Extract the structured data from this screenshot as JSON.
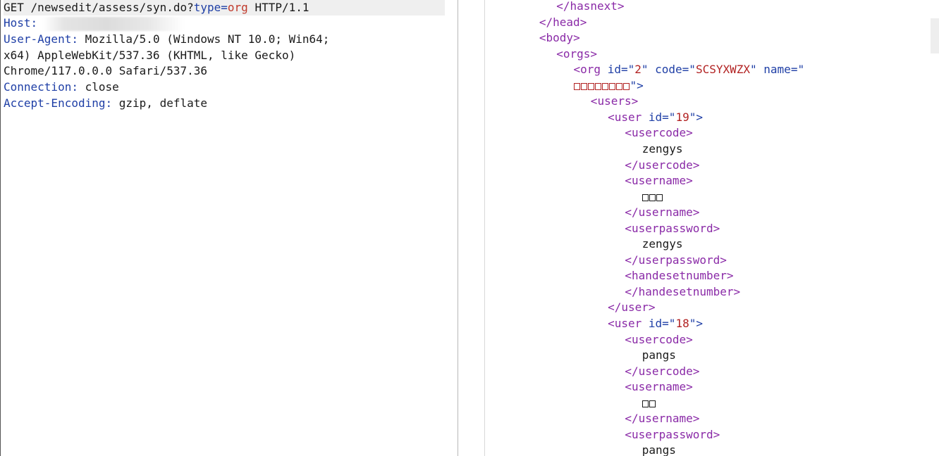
{
  "request": {
    "method": "GET",
    "path": "/newsedit/assess/syn.do?",
    "param_name": "type",
    "param_eq": "=",
    "param_value": "org",
    "protocol": "HTTP/1.1",
    "headers": [
      {
        "name": "Host:",
        "value": ""
      },
      {
        "name": "User-Agent:",
        "value": "Mozilla/5.0 (Windows NT 10.0; Win64;"
      },
      {
        "name": "",
        "value": "x64) AppleWebKit/537.36 (KHTML, like Gecko)"
      },
      {
        "name": "",
        "value": "Chrome/117.0.0.0 Safari/537.36"
      },
      {
        "name": "Connection:",
        "value": "close"
      },
      {
        "name": "Accept-Encoding:",
        "value": "gzip, deflate"
      }
    ]
  },
  "response": {
    "lines": [
      {
        "indent": 4,
        "kind": "close",
        "tag": "hasnext"
      },
      {
        "indent": 3,
        "kind": "close",
        "tag": "head"
      },
      {
        "indent": 3,
        "kind": "open",
        "tag": "body"
      },
      {
        "indent": 4,
        "kind": "open",
        "tag": "orgs"
      },
      {
        "indent": 5,
        "kind": "org-open",
        "tag": "org",
        "attrs": [
          {
            "name": "id",
            "value": "2"
          },
          {
            "name": "code",
            "value": "SCSYXWZX"
          },
          {
            "name": "name",
            "value": ""
          }
        ]
      },
      {
        "indent": 5,
        "kind": "org-name-cont",
        "boxes": 8,
        "tail": "\">"
      },
      {
        "indent": 6,
        "kind": "open",
        "tag": "users"
      },
      {
        "indent": 7,
        "kind": "user-open",
        "tag": "user",
        "attr": "id",
        "value": "19"
      },
      {
        "indent": 8,
        "kind": "open",
        "tag": "usercode"
      },
      {
        "indent": 9,
        "kind": "text",
        "text": "zengys"
      },
      {
        "indent": 8,
        "kind": "close",
        "tag": "usercode"
      },
      {
        "indent": 8,
        "kind": "open",
        "tag": "username"
      },
      {
        "indent": 9,
        "kind": "boxes",
        "boxes": 3
      },
      {
        "indent": 8,
        "kind": "close",
        "tag": "username"
      },
      {
        "indent": 8,
        "kind": "open",
        "tag": "userpassword"
      },
      {
        "indent": 9,
        "kind": "text",
        "text": "zengys"
      },
      {
        "indent": 8,
        "kind": "close",
        "tag": "userpassword"
      },
      {
        "indent": 8,
        "kind": "open",
        "tag": "handesetnumber"
      },
      {
        "indent": 8,
        "kind": "close",
        "tag": "handesetnumber"
      },
      {
        "indent": 7,
        "kind": "close",
        "tag": "user"
      },
      {
        "indent": 7,
        "kind": "user-open",
        "tag": "user",
        "attr": "id",
        "value": "18"
      },
      {
        "indent": 8,
        "kind": "open",
        "tag": "usercode"
      },
      {
        "indent": 9,
        "kind": "text",
        "text": "pangs"
      },
      {
        "indent": 8,
        "kind": "close",
        "tag": "usercode"
      },
      {
        "indent": 8,
        "kind": "open",
        "tag": "username"
      },
      {
        "indent": 9,
        "kind": "boxes",
        "boxes": 2
      },
      {
        "indent": 8,
        "kind": "close",
        "tag": "username"
      },
      {
        "indent": 8,
        "kind": "open",
        "tag": "userpassword"
      },
      {
        "indent": 9,
        "kind": "text",
        "text": "pangs"
      }
    ]
  },
  "colors": {
    "tag": "#8a2aa7",
    "attr": "#1f3fa6",
    "value": "#b22222",
    "header_name": "#1f3fa6"
  }
}
